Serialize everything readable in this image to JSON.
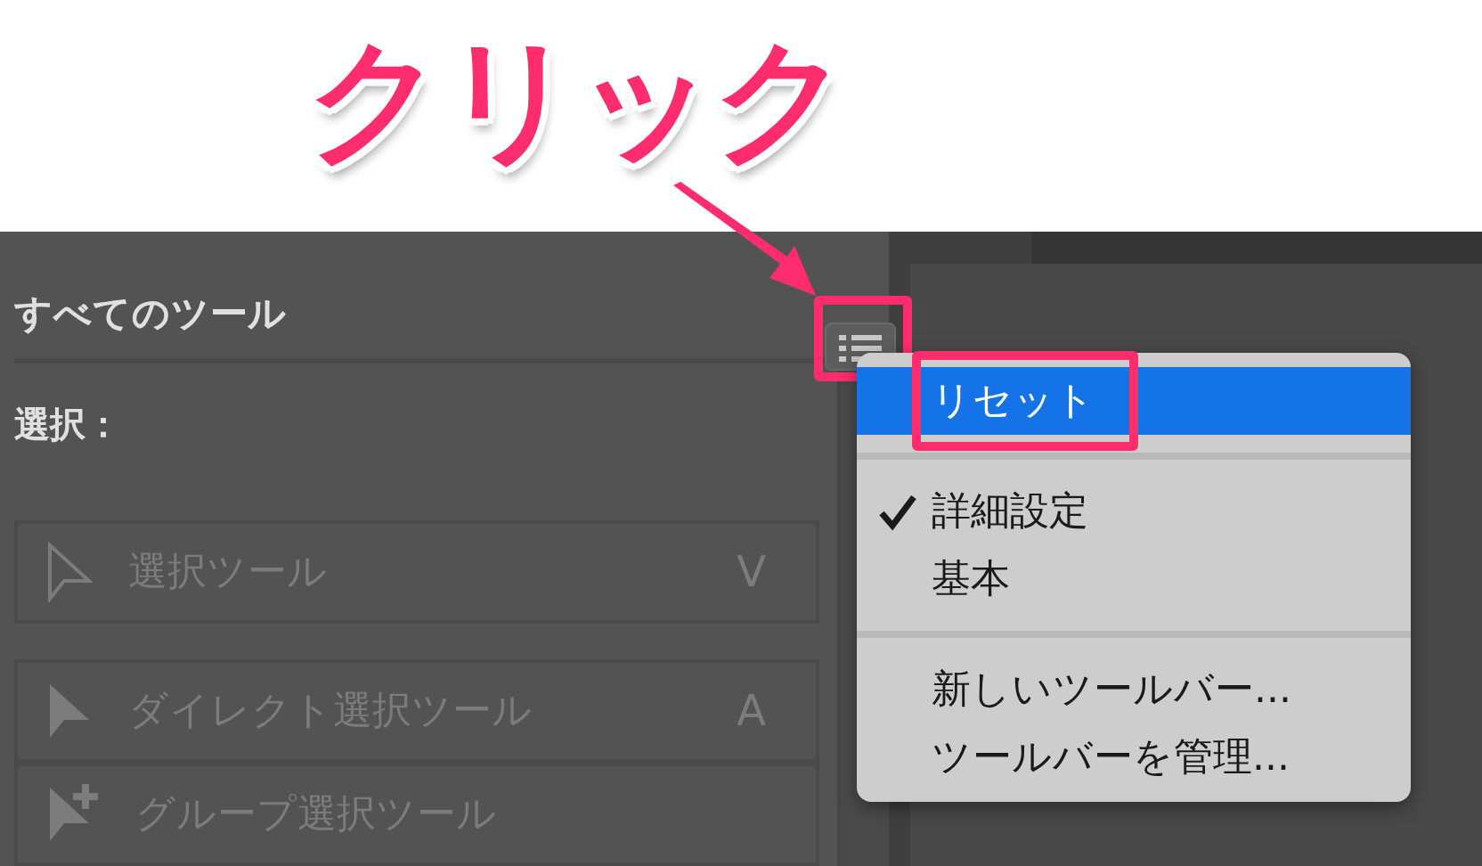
{
  "annotation": {
    "label": "クリック"
  },
  "panel": {
    "title": "すべてのツール",
    "section": "選択：",
    "tools": [
      {
        "label": "選択ツール",
        "shortcut": "V",
        "kind": "arrow-outline"
      },
      {
        "label": "ダイレクト選択ツール",
        "shortcut": "A",
        "kind": "arrow-solid"
      },
      {
        "label": "グループ選択ツール",
        "kind": "arrow-plus"
      }
    ]
  },
  "menu": {
    "groups": [
      [
        {
          "label": "リセット",
          "selected": true,
          "checked": false
        }
      ],
      [
        {
          "label": "詳細設定",
          "selected": false,
          "checked": true
        },
        {
          "label": "基本",
          "selected": false,
          "checked": false
        }
      ],
      [
        {
          "label": "新しいツールバー...",
          "selected": false,
          "checked": false
        },
        {
          "label": "ツールバーを管理...",
          "selected": false,
          "checked": false
        }
      ]
    ]
  }
}
